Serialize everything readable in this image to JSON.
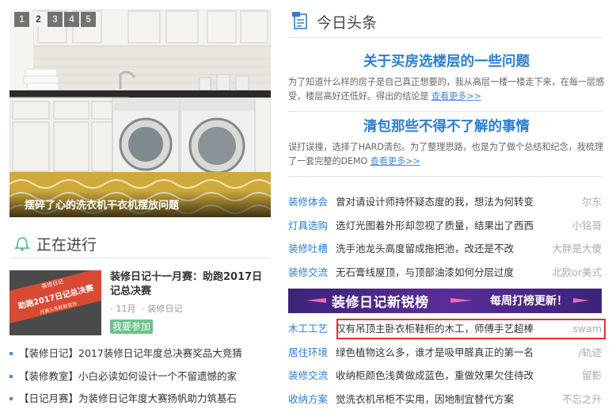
{
  "slideshow": {
    "pages": [
      "1",
      "2",
      "3",
      "4",
      "5"
    ],
    "active_page": "2",
    "caption": "摆碎了心的洗衣机干衣机摆放问题"
  },
  "ongoing": {
    "title": "正在进行",
    "feature": {
      "title": "装修日记十一月赛：助跑2017日记总决赛",
      "month": "11月",
      "category": "装修日记",
      "join_label": "我要参加",
      "thumb_text_top": "装修日记",
      "thumb_text_main": "助跑2017日记总决赛",
      "thumb_text_sub": "月赛头条新鲜登场"
    },
    "items": [
      "【装修日记】2017装修日记年度总决赛奖品大竞猜",
      "【装修教室】小白必读如何设计一个不留遗憾的家",
      "【日记月赛】为装修日记年度大赛扬帆助力筑基石"
    ]
  },
  "headlines": {
    "title": "今日头条",
    "articles": [
      {
        "title": "关于买房选楼层的一些问题",
        "summary": "为了知道什么样的房子是自己真正想要的，我从高层一楼一楼走下来，在每一层感受，楼层高好还低好。得出的结论是",
        "more": "查看更多>>"
      },
      {
        "title": "清包那些不得不了解的事情",
        "summary": "误打误撞，选择了HARD清包。为了整理思路，也是为了做个总结和纪念，我梳理了一套完整的DEMO",
        "more": "查看更多>>"
      }
    ],
    "list_top": [
      {
        "cat": "装修体会",
        "text": "曾对请设计师持怀疑态度的我，想法为何转变",
        "author": "尔东"
      },
      {
        "cat": "灯具选购",
        "text": "选灯光图着外形却忽视了质量，结果出了西西",
        "author": "小铭哥"
      },
      {
        "cat": "装修吐槽",
        "text": "洗手池龙头高度留成拖把池，改还是不改",
        "author": "大胖是大傻"
      },
      {
        "cat": "装修交流",
        "text": "无石膏线屋顶，与顶部油漆如何分层过度",
        "author": "北欧or美式"
      }
    ],
    "banner": {
      "main": "装修日记新锐榜",
      "sub": "每周打榜更新！"
    },
    "list_bottom": [
      {
        "cat": "木工工艺",
        "text": "仅有吊顶主卧衣柜鞋柜的木工，师傅手艺超棒",
        "author": "swam"
      },
      {
        "cat": "居住环境",
        "text": "绿色植物这么多，谁才是吸甲醛真正的第一名",
        "author": "/轨迹"
      },
      {
        "cat": "装修交流",
        "text": "收纳柜颜色浅黄做成蓝色，重做效果欠佳待改",
        "author": "留影"
      },
      {
        "cat": "收纳方案",
        "text": "觉洗衣机吊柜不实用，因地制宜替代方案",
        "author": "不忘之升"
      }
    ]
  },
  "colors": {
    "accent_blue": "#2b7ed2",
    "join_green": "#6dc28a",
    "banner_purple": "#4b2a8a",
    "highlight_red": "#e52e2e"
  }
}
